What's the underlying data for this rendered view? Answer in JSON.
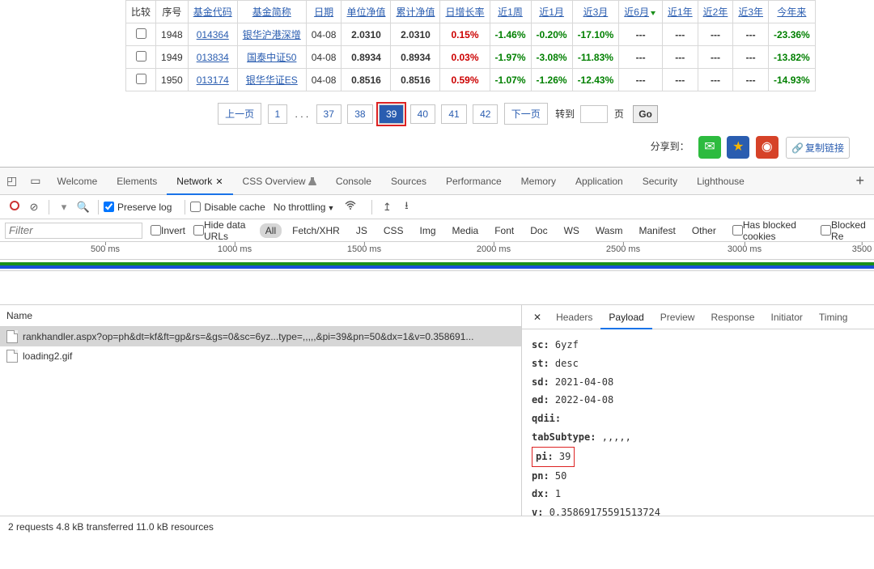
{
  "table": {
    "headers": {
      "compare": "比较",
      "index": "序号",
      "code": "基金代码",
      "name": "基金简称",
      "date": "日期",
      "nav": "单位净值",
      "accnav": "累计净值",
      "daily": "日增长率",
      "w1": "近1周",
      "m1": "近1月",
      "m3": "近3月",
      "m6": "近6月",
      "y1": "近1年",
      "y2": "近2年",
      "y3": "近3年",
      "ytd": "今年来"
    },
    "rows": [
      {
        "idx": "1948",
        "code": "014364",
        "name": "银华沪港深增",
        "date": "04-08",
        "nav": "2.0310",
        "accnav": "2.0310",
        "daily": "0.15%",
        "w1": "-1.46%",
        "m1": "-0.20%",
        "m3": "-17.10%",
        "m6": "---",
        "y1": "---",
        "y2": "---",
        "y3": "---",
        "ytd": "-23.36%"
      },
      {
        "idx": "1949",
        "code": "013834",
        "name": "国泰中证50",
        "date": "04-08",
        "nav": "0.8934",
        "accnav": "0.8934",
        "daily": "0.03%",
        "w1": "-1.97%",
        "m1": "-3.08%",
        "m3": "-11.83%",
        "m6": "---",
        "y1": "---",
        "y2": "---",
        "y3": "---",
        "ytd": "-13.82%"
      },
      {
        "idx": "1950",
        "code": "013174",
        "name": "银华华证ES",
        "date": "04-08",
        "nav": "0.8516",
        "accnav": "0.8516",
        "daily": "0.59%",
        "w1": "-1.07%",
        "m1": "-1.26%",
        "m3": "-12.43%",
        "m6": "---",
        "y1": "---",
        "y2": "---",
        "y3": "---",
        "ytd": "-14.93%"
      }
    ]
  },
  "pagination": {
    "prev": "上一页",
    "p1": "1",
    "dots": ". . .",
    "p37": "37",
    "p38": "38",
    "p39": "39",
    "p40": "40",
    "p41": "41",
    "p42": "42",
    "next": "下一页",
    "goto_label": "转到",
    "page_suffix": "页",
    "go": "Go"
  },
  "share": {
    "label": "分享到：",
    "copy": "复制链接"
  },
  "devtools": {
    "tabs": {
      "welcome": "Welcome",
      "elements": "Elements",
      "network": "Network",
      "cssoverview": "CSS Overview",
      "console": "Console",
      "sources": "Sources",
      "performance": "Performance",
      "memory": "Memory",
      "application": "Application",
      "security": "Security",
      "lighthouse": "Lighthouse"
    },
    "toolbar": {
      "preserve": "Preserve log",
      "disablecache": "Disable cache",
      "throttling": "No throttling"
    },
    "filter": {
      "placeholder": "Filter",
      "invert": "Invert",
      "hidedata": "Hide data URLs",
      "types": {
        "all": "All",
        "fetch": "Fetch/XHR",
        "js": "JS",
        "css": "CSS",
        "img": "Img",
        "media": "Media",
        "font": "Font",
        "doc": "Doc",
        "ws": "WS",
        "wasm": "Wasm",
        "manifest": "Manifest",
        "other": "Other"
      },
      "blockedcookies": "Has blocked cookies",
      "blockedreq": "Blocked Re"
    },
    "timeline": {
      "t1": "500 ms",
      "t2": "1000 ms",
      "t3": "1500 ms",
      "t4": "2000 ms",
      "t5": "2500 ms",
      "t6": "3000 ms",
      "t7": "3500"
    },
    "left": {
      "header": "Name",
      "req1": "rankhandler.aspx?op=ph&dt=kf&ft=gp&rs=&gs=0&sc=6yz...type=,,,,,&pi=39&pn=50&dx=1&v=0.358691...",
      "req2": "loading2.gif"
    },
    "subtabs": {
      "headers": "Headers",
      "payload": "Payload",
      "preview": "Preview",
      "response": "Response",
      "initiator": "Initiator",
      "timing": "Timing"
    },
    "payload": {
      "sc_k": "sc:",
      "sc_v": "6yzf",
      "st_k": "st:",
      "st_v": "desc",
      "sd_k": "sd:",
      "sd_v": "2021-04-08",
      "ed_k": "ed:",
      "ed_v": "2022-04-08",
      "qdii_k": "qdii:",
      "tabSubtype_k": "tabSubtype:",
      "tabSubtype_v": ",,,,,",
      "pi_k": "pi:",
      "pi_v": "39",
      "pn_k": "pn:",
      "pn_v": "50",
      "dx_k": "dx:",
      "dx_v": "1",
      "v_k": "v:",
      "v_v": "0.35869175591513724"
    },
    "status": "2 requests   4.8 kB transferred   11.0 kB resources"
  }
}
